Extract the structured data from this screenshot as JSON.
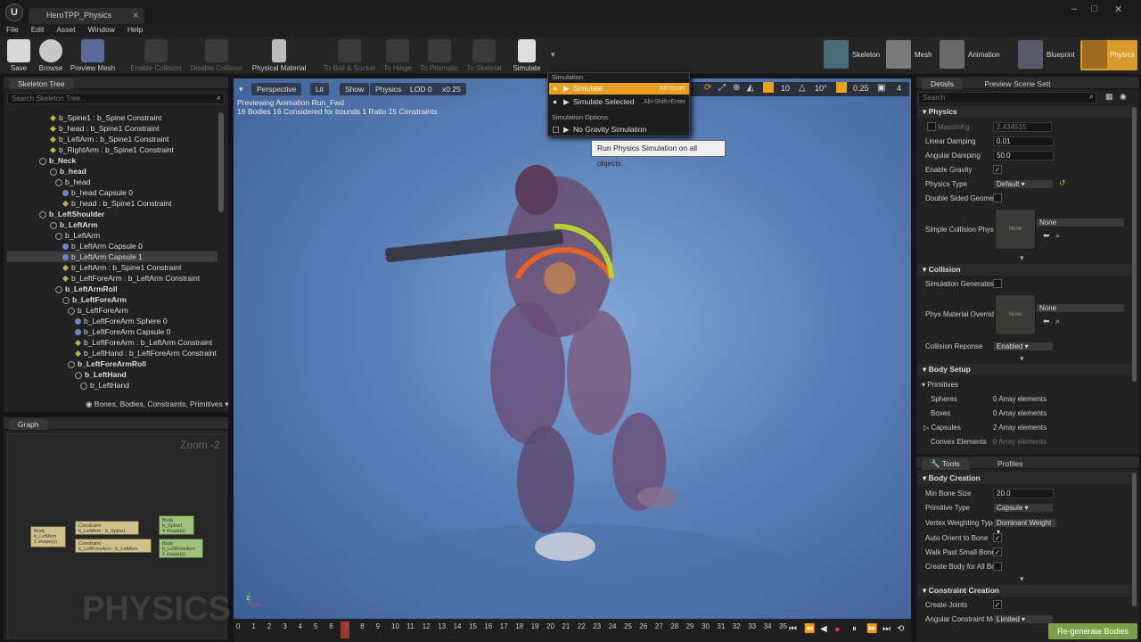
{
  "window": {
    "tab_title": "HeroTPP_Physics",
    "min": "–",
    "max": "□",
    "close": "✕"
  },
  "menu": [
    "File",
    "Edit",
    "Asset",
    "Window",
    "Help"
  ],
  "toolbar": {
    "save": "Save",
    "browse": "Browse",
    "preview_mesh": "Preview Mesh",
    "enable_collision": "Enable Collision",
    "disable_collision": "Disable Collision",
    "physical_material": "Physical Material",
    "to_ball": "To Ball & Socket",
    "to_hinge": "To Hinge",
    "to_prismatic": "To Prismatic",
    "to_skeletal": "To Skeletal",
    "simulate": "Simulate"
  },
  "modes": {
    "skeleton": "Skeleton",
    "mesh": "Mesh",
    "animation": "Animation",
    "blueprint": "Blueprint",
    "physics": "Physics"
  },
  "skeleton_tree": {
    "tab": "Skeleton Tree",
    "search_placeholder": "Search Skeleton Tree...",
    "rows": [
      {
        "text": "b_Spine1 : b_Spine Constraint",
        "kind": "cst",
        "indent": 48,
        "bold": false
      },
      {
        "text": "b_head : b_Spine1 Constraint",
        "kind": "cst",
        "indent": 48,
        "bold": false
      },
      {
        "text": "b_LeftArm : b_Spine1 Constraint",
        "kind": "cst",
        "indent": 48,
        "bold": false
      },
      {
        "text": "b_RightArm : b_Spine1 Constraint",
        "kind": "cst",
        "indent": 48,
        "bold": false
      },
      {
        "text": "b_Neck",
        "kind": "bone",
        "indent": 36,
        "bold": true
      },
      {
        "text": "b_head",
        "kind": "bone",
        "indent": 48,
        "bold": true
      },
      {
        "text": "b_head",
        "kind": "bone",
        "indent": 54,
        "bold": false
      },
      {
        "text": "b_head Capsule 0",
        "kind": "dot",
        "indent": 62,
        "bold": false
      },
      {
        "text": "b_head : b_Spine1 Constraint",
        "kind": "cst",
        "indent": 62,
        "bold": false
      },
      {
        "text": "b_LeftShoulder",
        "kind": "bone",
        "indent": 36,
        "bold": true
      },
      {
        "text": "b_LeftArm",
        "kind": "bone",
        "indent": 48,
        "bold": true
      },
      {
        "text": "b_LeftArm",
        "kind": "bone",
        "indent": 54,
        "bold": false
      },
      {
        "text": "b_LeftArm Capsule 0",
        "kind": "dot",
        "indent": 62,
        "bold": false
      },
      {
        "text": "b_LeftArm Capsule 1",
        "kind": "dot",
        "indent": 62,
        "bold": false,
        "sel": true
      },
      {
        "text": "b_LeftArm : b_Spine1 Constraint",
        "kind": "cst",
        "indent": 62,
        "bold": false
      },
      {
        "text": "b_LeftForeArm : b_LeftArm Constraint",
        "kind": "cst",
        "indent": 62,
        "bold": false
      },
      {
        "text": "b_LeftArmRoll",
        "kind": "bone",
        "indent": 54,
        "bold": true
      },
      {
        "text": "b_LeftForeArm",
        "kind": "bone",
        "indent": 62,
        "bold": true
      },
      {
        "text": "b_LeftForeArm",
        "kind": "bone",
        "indent": 68,
        "bold": false
      },
      {
        "text": "b_LeftForeArm Sphere 0",
        "kind": "dot",
        "indent": 76,
        "bold": false
      },
      {
        "text": "b_LeftForeArm Capsule 0",
        "kind": "dot",
        "indent": 76,
        "bold": false
      },
      {
        "text": "b_LeftForeArm : b_LeftArm Constraint",
        "kind": "cst",
        "indent": 76,
        "bold": false
      },
      {
        "text": "b_LeftHand : b_LeftForeArm Constraint",
        "kind": "cst",
        "indent": 76,
        "bold": false
      },
      {
        "text": "b_LeftForeArmRoll",
        "kind": "bone",
        "indent": 68,
        "bold": true
      },
      {
        "text": "b_LeftHand",
        "kind": "bone",
        "indent": 76,
        "bold": true
      },
      {
        "text": "b_LeftHand",
        "kind": "bone",
        "indent": 82,
        "bold": false
      }
    ],
    "filter": "Bones, Bodies, Constraints, Primitives"
  },
  "graph": {
    "tab": "Graph",
    "zoom": "Zoom -2",
    "watermark": "PHYSICS",
    "nodes": [
      {
        "t1": "Body",
        "t2": "b_LeftArm",
        "t3": "1 shape(s)",
        "green": false
      },
      {
        "t1": "Constraint",
        "t2": "b_LeftArm : b_Spine1",
        "t3": "",
        "green": false
      },
      {
        "t1": "Constraint",
        "t2": "b_LeftForeArm : b_LeftArm",
        "t3": "",
        "green": false
      },
      {
        "t1": "Body",
        "t2": "b_Spine1",
        "t3": "4 shape(s)",
        "green": true
      },
      {
        "t1": "Body",
        "t2": "b_LeftForeArm",
        "t3": "2 shape(s)",
        "green": true
      }
    ]
  },
  "viewport": {
    "perspective": "Perspective",
    "lit": "Lit",
    "show": "Show",
    "physics": "Physics",
    "lod": "LOD 0",
    "speed": "x0.25",
    "info1": "Previewing Animation Run_Fwd",
    "info2": "16 Bodies  16 Considered for bounds  1 Ratio  15 Constraints",
    "snap_grid": "10",
    "snap_rot": "10°",
    "snap_scale": "0.25",
    "cam_speed": "4"
  },
  "sim_menu": {
    "header": "Simulation",
    "items": [
      {
        "label": "Simulate",
        "shortcut": "Alt+Enter",
        "highlight": true
      },
      {
        "label": "Simulate Selected",
        "shortcut": "Alt+Shift+Enter",
        "highlight": false
      }
    ],
    "options_header": "Simulation Options",
    "no_gravity": "No Gravity Simulation"
  },
  "tooltip": "Run Physics Simulation on all objects.",
  "details": {
    "tab": "Details",
    "tab2": "Preview Scene Sett",
    "search_placeholder": "Search",
    "physics_header": "Physics",
    "mass_label": "MassInKg",
    "mass_value": "2.434515",
    "linear_damping_label": "Linear Damping",
    "linear_damping": "0.01",
    "angular_damping_label": "Angular Damping",
    "angular_damping": "50.0",
    "enable_gravity_label": "Enable Gravity",
    "physics_type_label": "Physics Type",
    "physics_type": "Default",
    "double_sided_label": "Double Sided Geometr",
    "simple_collision_label": "Simple Collision Phys",
    "none": "None",
    "collision_header": "Collision",
    "sim_generates_label": "Simulation Generates",
    "phys_mat_label": "Phys Material Overrid",
    "collision_response_label": "Collision Reponse",
    "collision_response": "Enabled",
    "body_setup_header": "Body Setup",
    "primitives_header": "Primitives",
    "spheres_label": "Spheres",
    "spheres": "0 Array elements",
    "boxes_label": "Boxes",
    "boxes": "0 Array elements",
    "capsules_label": "Capsules",
    "capsules": "2 Array elements",
    "convex_label": "Convex Elements",
    "convex": "0 Array elements"
  },
  "tools": {
    "tab": "Tools",
    "tab2": "Profiles",
    "body_creation_header": "Body Creation",
    "min_bone_label": "Min Bone Size",
    "min_bone": "20.0",
    "prim_type_label": "Primitive Type",
    "prim_type": "Capsule",
    "vertex_label": "Vertex Weighting Type",
    "vertex": "Dominant Weight",
    "auto_orient_label": "Auto Orient to Bone",
    "walk_past_label": "Walk Past Small Bone",
    "create_body_label": "Create Body for All Bo",
    "constraint_header": "Constraint Creation",
    "create_joints_label": "Create Joints",
    "angular_mode_label": "Angular Constraint Mo",
    "angular_mode": "Limited",
    "regen": "Re-generate Bodies"
  },
  "timeline": {
    "ticks": [
      "0",
      "1",
      "2",
      "3",
      "4",
      "5",
      "6",
      "7",
      "8",
      "9",
      "10",
      "11",
      "12",
      "13",
      "14",
      "15",
      "16",
      "17",
      "18",
      "19",
      "20",
      "21",
      "22",
      "23",
      "24",
      "25",
      "26",
      "27",
      "28",
      "29",
      "30",
      "31",
      "32",
      "33",
      "34",
      "35"
    ],
    "current": "7"
  },
  "colors": {
    "accent": "#e8a020",
    "physics_mode": "#d89a2a",
    "regen": "#7aa04a"
  }
}
